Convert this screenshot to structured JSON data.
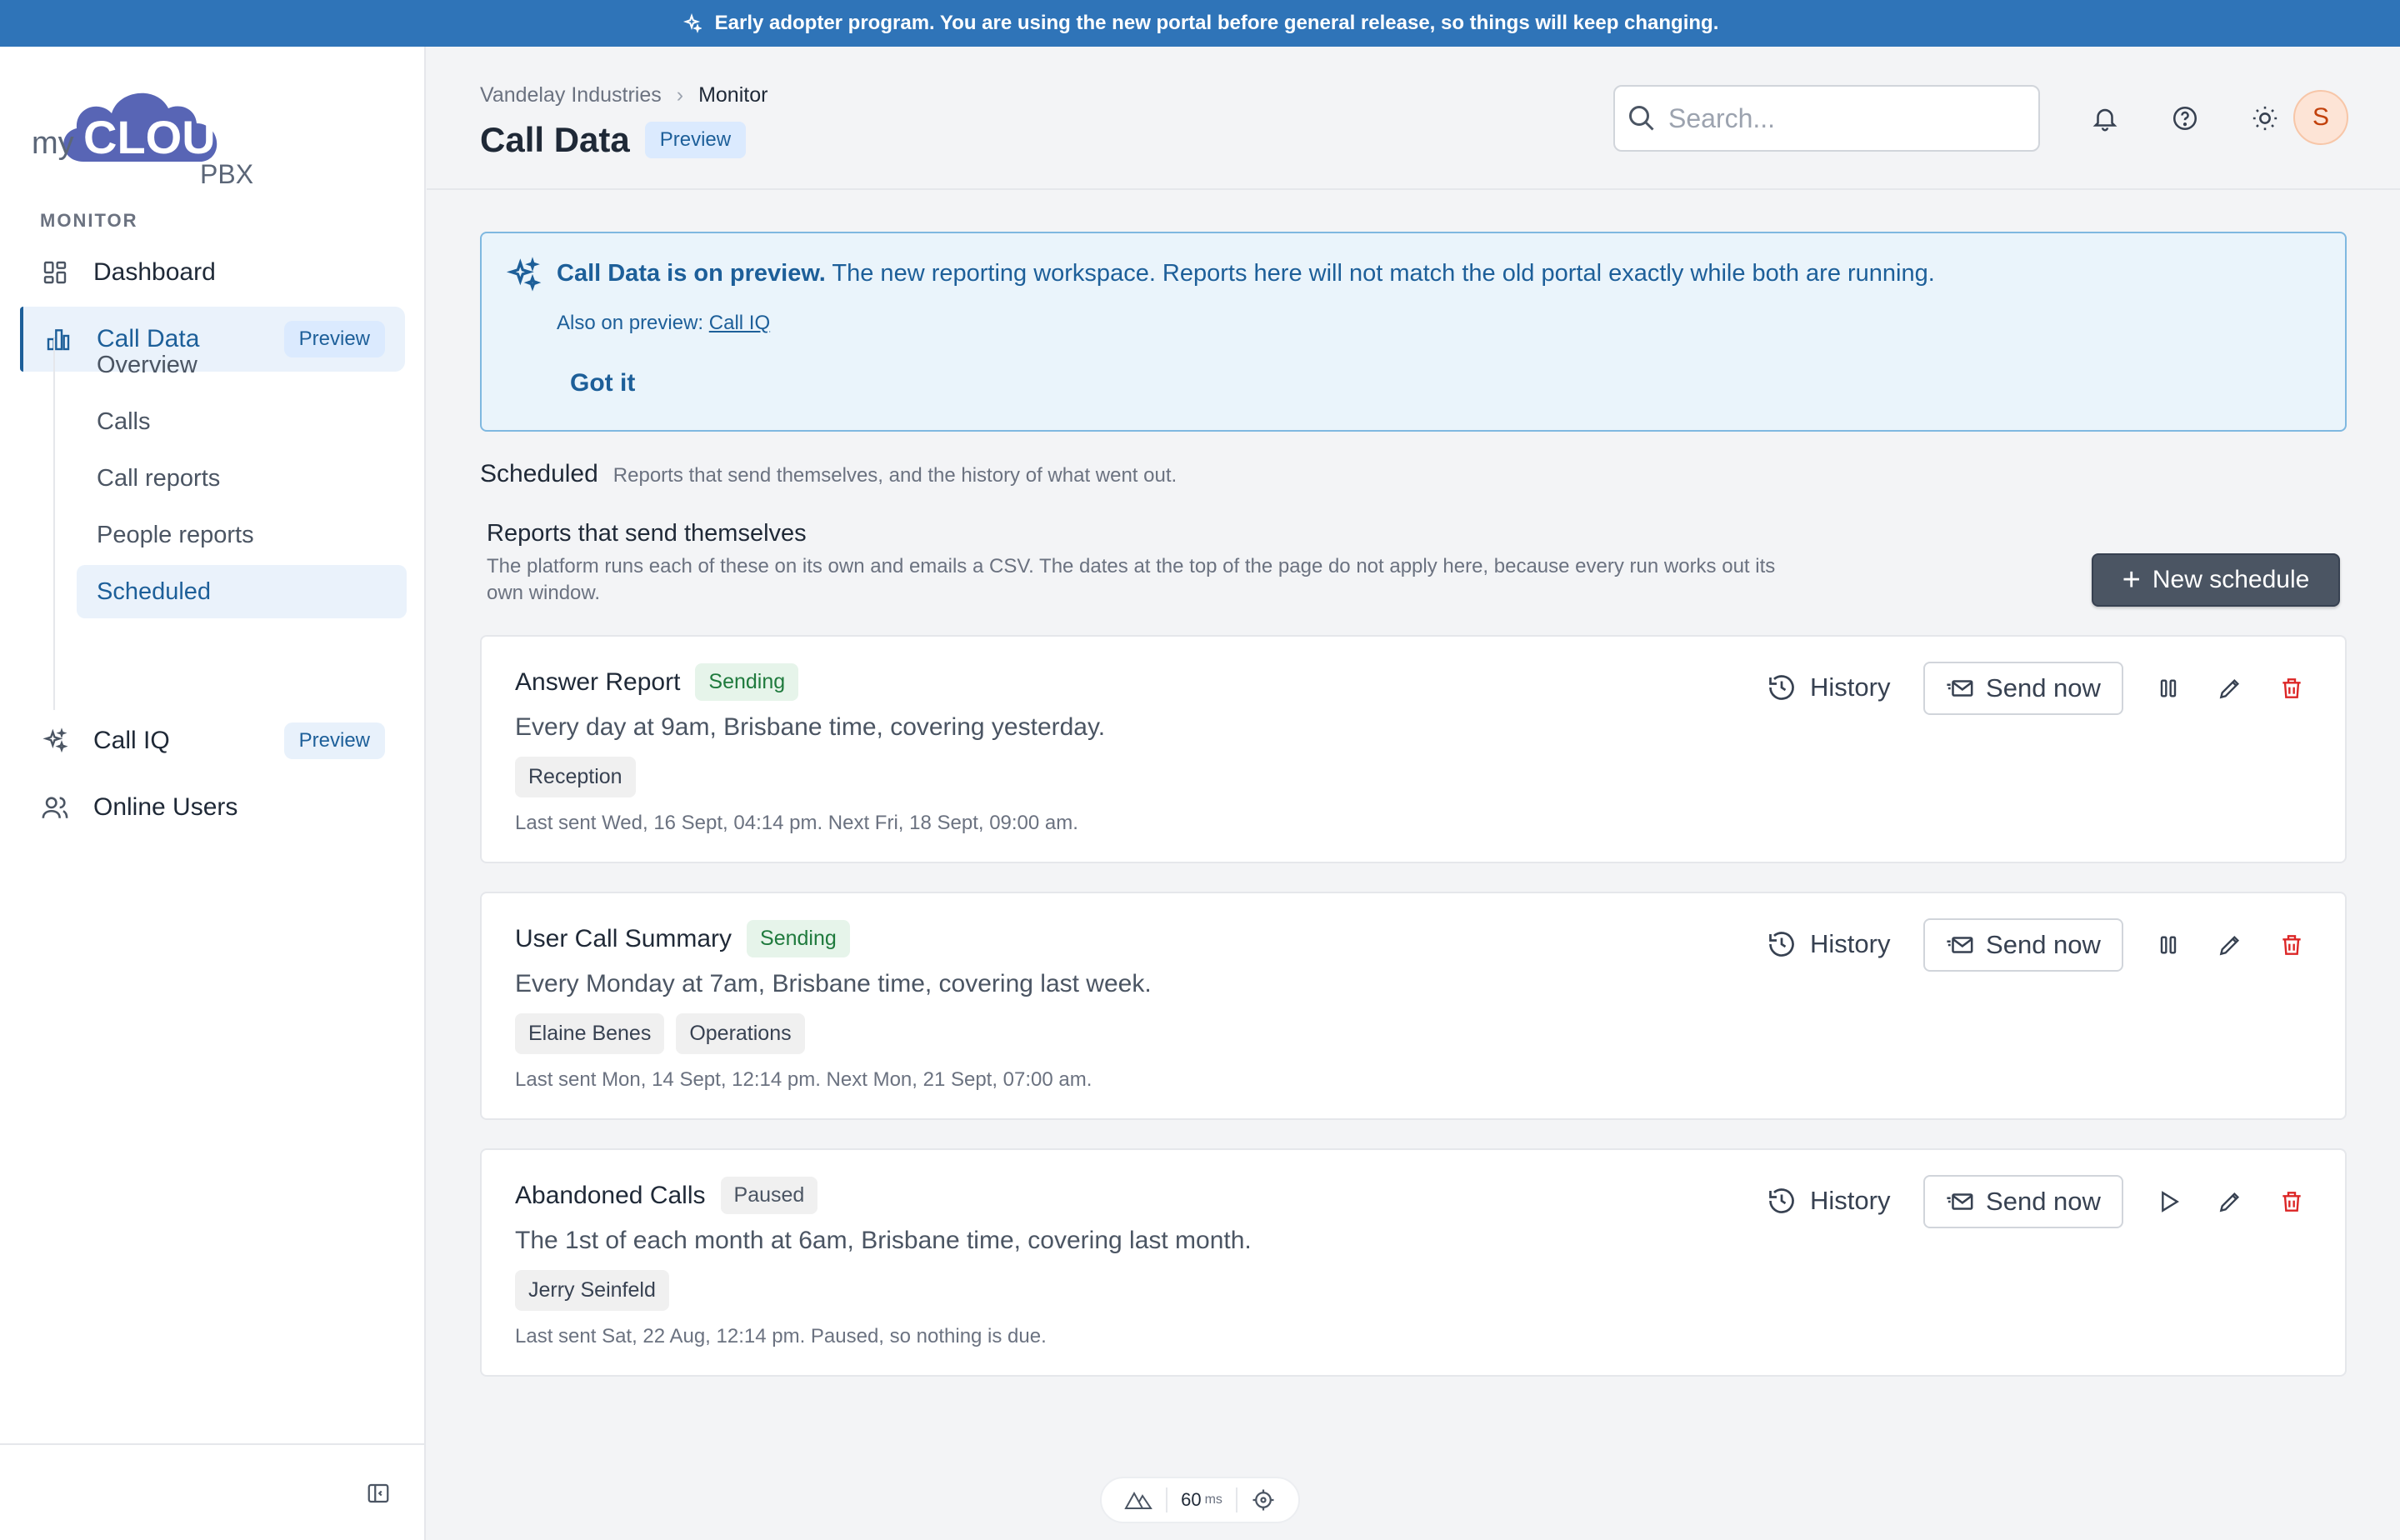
{
  "banner": {
    "text": "Early adopter program. You are using the new portal before general release, so things will keep changing."
  },
  "logo": {
    "my": "my",
    "cloud": "CLOUD",
    "pbx": "PBX"
  },
  "sidebar": {
    "section_label": "MONITOR",
    "items": [
      {
        "label": "Dashboard",
        "icon": "dashboard-icon"
      },
      {
        "label": "Call Data",
        "icon": "bar-chart-icon",
        "badge": "Preview",
        "active": true
      },
      {
        "label": "Call IQ",
        "icon": "sparkle-icon",
        "badge": "Preview"
      },
      {
        "label": "Online Users",
        "icon": "users-icon"
      }
    ],
    "subitems": [
      {
        "label": "Overview"
      },
      {
        "label": "Calls"
      },
      {
        "label": "Call reports"
      },
      {
        "label": "People reports"
      },
      {
        "label": "Scheduled",
        "active": true
      }
    ]
  },
  "header": {
    "breadcrumb": [
      "Vandelay Industries",
      "Monitor"
    ],
    "title": "Call Data",
    "title_badge": "Preview",
    "search_placeholder": "Search...",
    "avatar_initial": "S"
  },
  "alert": {
    "title_bold": "Call Data is on preview.",
    "title_rest": " The new reporting workspace. Reports here will not match the old portal exactly while both are running.",
    "sub_prefix": "Also on preview: ",
    "sub_link": "Call IQ",
    "button": "Got it"
  },
  "scheduled": {
    "heading": "Scheduled",
    "heading_desc": "Reports that send themselves, and the history of what went out.",
    "section_title": "Reports that send themselves",
    "section_desc": "The platform runs each of these on its own and emails a CSV. The dates at the top of the page do not apply here, because every run works out its own window.",
    "new_button": "New schedule",
    "history_label": "History",
    "send_now_label": "Send now",
    "reports": [
      {
        "name": "Answer Report",
        "status": "Sending",
        "schedule": "Every day at 9am, Brisbane time, covering yesterday.",
        "tags": [
          "Reception"
        ],
        "meta": "Last sent Wed, 16 Sept, 04:14 pm. Next Fri, 18 Sept, 09:00 am.",
        "toggle_icon": "pause-icon"
      },
      {
        "name": "User Call Summary",
        "status": "Sending",
        "schedule": "Every Monday at 7am, Brisbane time, covering last week.",
        "tags": [
          "Elaine Benes",
          "Operations"
        ],
        "meta": "Last sent Mon, 14 Sept, 12:14 pm. Next Mon, 21 Sept, 07:00 am.",
        "toggle_icon": "pause-icon"
      },
      {
        "name": "Abandoned Calls",
        "status": "Paused",
        "schedule": "The 1st of each month at 6am, Brisbane time, covering last month.",
        "tags": [
          "Jerry Seinfeld"
        ],
        "meta": "Last sent Sat, 22 Aug, 12:14 pm. Paused, so nothing is due.",
        "toggle_icon": "play-icon"
      }
    ]
  },
  "devtools": {
    "latency": "60",
    "unit": "ms"
  },
  "colors": {
    "brand": "#2f74b8",
    "accent": "#1d5f99",
    "danger": "#dc2626",
    "success": "#1f7a3d"
  }
}
